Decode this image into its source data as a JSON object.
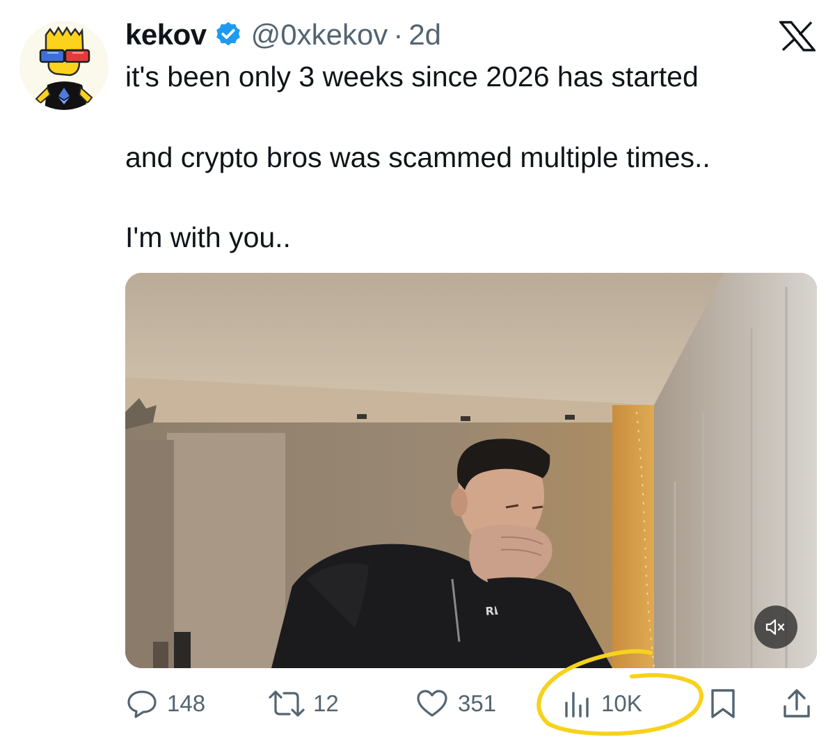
{
  "tweet": {
    "display_name": "kekov",
    "handle": "@0xkekov",
    "separator": "·",
    "time": "2d",
    "text_lines": [
      "it's been only 3 weeks since 2026 has started",
      "and crypto bros was scammed multiple times..",
      "I'm with you.."
    ]
  },
  "media": {
    "hoodie_text": "REBE"
  },
  "actions": {
    "replies": "148",
    "reposts": "12",
    "likes": "351",
    "views": "10K"
  },
  "icons": {
    "avatar": "bart-avatar",
    "verified": "verified-badge-icon",
    "brand": "x-logo-icon",
    "mute": "mute-icon",
    "reply": "reply-icon",
    "repost": "repost-icon",
    "like": "heart-icon",
    "views": "views-chart-icon",
    "bookmark": "bookmark-icon",
    "share": "share-icon"
  },
  "colors": {
    "verified": "#1d9bf0",
    "text_secondary": "#536471",
    "highlight_annotation": "#f7d21c"
  }
}
